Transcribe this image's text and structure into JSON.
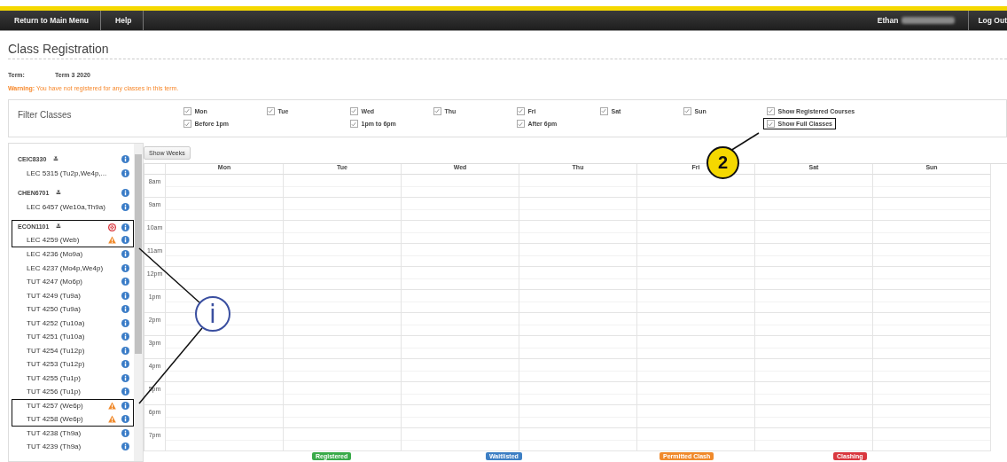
{
  "nav": {
    "left": [
      "Return to Main Menu",
      "Help"
    ],
    "user": "Ethan",
    "logout": "Log Out"
  },
  "title": "Class Registration",
  "term": {
    "label": "Term:",
    "value": "Term 3 2020"
  },
  "warning": {
    "label": "Warning:",
    "text": "You have not registered for any classes in this term."
  },
  "filter": {
    "title": "Filter Classes",
    "rows": [
      [
        {
          "label": "Mon",
          "checked": true,
          "outlined": false
        },
        {
          "label": "Tue",
          "checked": true,
          "outlined": false
        },
        {
          "label": "Wed",
          "checked": true,
          "outlined": false
        },
        {
          "label": "Thu",
          "checked": true,
          "outlined": false
        },
        {
          "label": "Fri",
          "checked": true,
          "outlined": false
        },
        {
          "label": "Sat",
          "checked": true,
          "outlined": false
        },
        {
          "label": "Sun",
          "checked": true,
          "outlined": false
        },
        {
          "label": "Show Registered Courses",
          "checked": true,
          "outlined": false
        }
      ],
      [
        {
          "label": "Before 1pm",
          "checked": true,
          "outlined": false
        },
        null,
        {
          "label": "1pm to 6pm",
          "checked": true,
          "outlined": false
        },
        null,
        {
          "label": "After 6pm",
          "checked": true,
          "outlined": false
        },
        null,
        null,
        {
          "label": "Show Full Classes",
          "checked": true,
          "outlined": true
        }
      ]
    ]
  },
  "sidebar": {
    "items": [
      {
        "kind": "course",
        "label": "CEIC8330",
        "toggle": "≚",
        "warning": false,
        "error": false,
        "outlined": false
      },
      {
        "kind": "section",
        "label": "LEC 5315 (Tu2p,We4p,...",
        "warning": false,
        "error": false,
        "outlined": false
      },
      {
        "kind": "course",
        "label": "CHEN6701",
        "toggle": "≚",
        "warning": false,
        "error": false,
        "outlined": false
      },
      {
        "kind": "section",
        "label": "LEC 6457 (We10a,Th9a)",
        "warning": false,
        "error": false,
        "outlined": false
      },
      {
        "kind": "course",
        "label": "ECON1101",
        "toggle": "≚",
        "warning": false,
        "error": true,
        "outlined": true
      },
      {
        "kind": "section",
        "label": "LEC 4259 (Web)",
        "warning": true,
        "error": false,
        "outlined": true
      },
      {
        "kind": "section",
        "label": "LEC 4236 (Mo9a)",
        "warning": false,
        "error": false,
        "outlined": false
      },
      {
        "kind": "section",
        "label": "LEC 4237 (Mo4p,We4p)",
        "warning": false,
        "error": false,
        "outlined": false
      },
      {
        "kind": "section",
        "label": "TUT 4247 (Mo6p)",
        "warning": false,
        "error": false,
        "outlined": false
      },
      {
        "kind": "section",
        "label": "TUT 4249 (Tu9a)",
        "warning": false,
        "error": false,
        "outlined": false
      },
      {
        "kind": "section",
        "label": "TUT 4250 (Tu9a)",
        "warning": false,
        "error": false,
        "outlined": false
      },
      {
        "kind": "section",
        "label": "TUT 4252 (Tu10a)",
        "warning": false,
        "error": false,
        "outlined": false
      },
      {
        "kind": "section",
        "label": "TUT 4251 (Tu10a)",
        "warning": false,
        "error": false,
        "outlined": false
      },
      {
        "kind": "section",
        "label": "TUT 4254 (Tu12p)",
        "warning": false,
        "error": false,
        "outlined": false
      },
      {
        "kind": "section",
        "label": "TUT 4253 (Tu12p)",
        "warning": false,
        "error": false,
        "outlined": false
      },
      {
        "kind": "section",
        "label": "TUT 4255 (Tu1p)",
        "warning": false,
        "error": false,
        "outlined": false
      },
      {
        "kind": "section",
        "label": "TUT 4256 (Tu1p)",
        "warning": false,
        "error": false,
        "outlined": false
      },
      {
        "kind": "section",
        "label": "TUT 4257 (We6p)",
        "warning": true,
        "error": false,
        "outlined": true
      },
      {
        "kind": "section",
        "label": "TUT 4258 (We6p)",
        "warning": true,
        "error": false,
        "outlined": true
      },
      {
        "kind": "section",
        "label": "TUT 4238 (Th9a)",
        "warning": false,
        "error": false,
        "outlined": false
      },
      {
        "kind": "section",
        "label": "TUT 4239 (Th9a)",
        "warning": false,
        "error": false,
        "outlined": false
      }
    ]
  },
  "calendar": {
    "button": "Show Weeks",
    "days": [
      "Mon",
      "Tue",
      "Wed",
      "Thu",
      "Fri",
      "Sat",
      "Sun"
    ],
    "hours": [
      "8am",
      "9am",
      "10am",
      "11am",
      "12pm",
      "1pm",
      "2pm",
      "3pm",
      "4pm",
      "5pm",
      "6pm",
      "7pm"
    ],
    "legend": [
      {
        "label": "Registered",
        "color": "#3aaa4a"
      },
      {
        "label": "Waitlisted",
        "color": "#3d7fc4"
      },
      {
        "label": "Permitted Clash",
        "color": "#f08a2c"
      },
      {
        "label": "Clashing",
        "color": "#d9383f"
      }
    ]
  },
  "callouts": [
    {
      "text": "2",
      "kind": "number"
    },
    {
      "text": "i",
      "kind": "info"
    }
  ]
}
